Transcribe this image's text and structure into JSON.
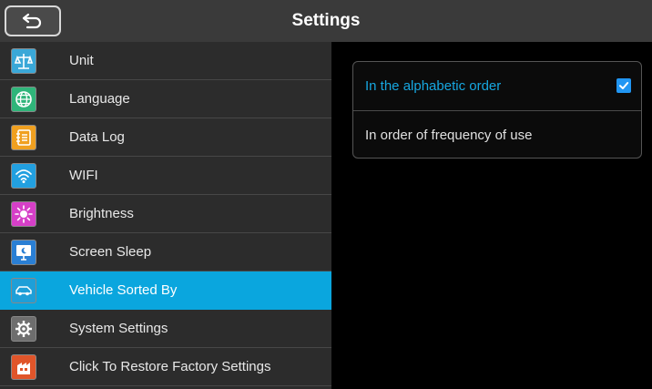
{
  "header": {
    "title": "Settings",
    "back_icon": "back-arrow-icon"
  },
  "menu": {
    "items": [
      {
        "label": "Unit",
        "icon": "scale-icon",
        "color": "#3aa8d8"
      },
      {
        "label": "Language",
        "icon": "globe-icon",
        "color": "#2fb57a"
      },
      {
        "label": "Data Log",
        "icon": "notebook-icon",
        "color": "#f0a020"
      },
      {
        "label": "WIFI",
        "icon": "wifi-icon",
        "color": "#22a0e0"
      },
      {
        "label": "Brightness",
        "icon": "sun-icon",
        "color": "#d63fc8"
      },
      {
        "label": "Screen Sleep",
        "icon": "monitor-moon-icon",
        "color": "#2a7fd4"
      },
      {
        "label": "Vehicle Sorted By",
        "icon": "car-icon",
        "color": "#1e9fd8",
        "active": true
      },
      {
        "label": "System Settings",
        "icon": "gear-icon",
        "color": "#6e6e6e"
      },
      {
        "label": "Click To Restore Factory Settings",
        "icon": "factory-reset-icon",
        "color": "#e0552a"
      }
    ]
  },
  "sort_options": [
    {
      "label": "In the alphabetic order",
      "selected": true
    },
    {
      "label": "In order of frequency of use",
      "selected": false
    }
  ],
  "colors": {
    "accent": "#0aa6de",
    "selected_text": "#17a7e0",
    "checkbox": "#2196f3"
  }
}
